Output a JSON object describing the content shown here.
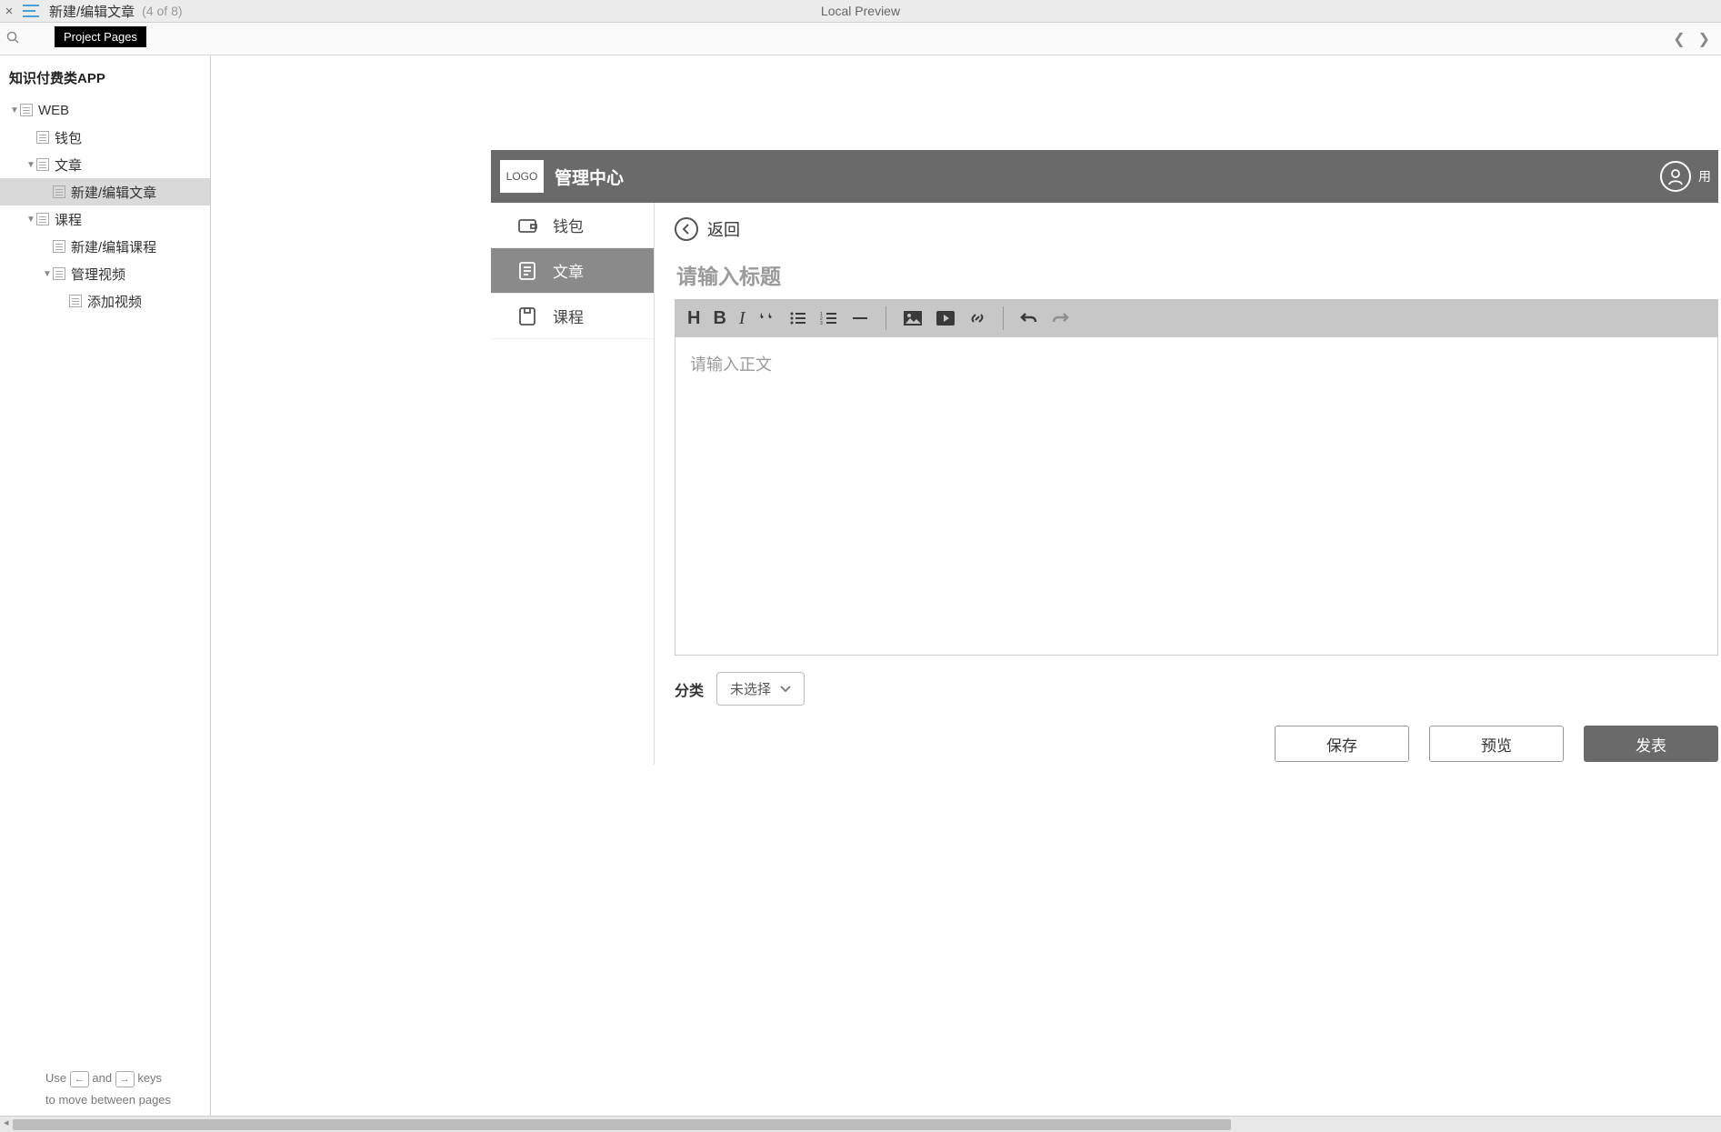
{
  "toolbar": {
    "page_title": "新建/编辑文章",
    "page_count": "(4 of 8)",
    "preview_label": "Local Preview",
    "tooltip": "Project Pages"
  },
  "project": {
    "title": "知识付费类APP"
  },
  "tree": {
    "web": "WEB",
    "wallet": "钱包",
    "article": "文章",
    "article_new": "新建/编辑文章",
    "course": "课程",
    "course_new": "新建/编辑课程",
    "video_manage": "管理视频",
    "video_add": "添加视频"
  },
  "footer": {
    "line1_pre": "Use",
    "key_left": "←",
    "line1_and": "and",
    "key_right": "→",
    "line1_post": "keys",
    "line2": "to move between pages"
  },
  "mockup": {
    "logo": "LOGO",
    "header_title": "管理中心",
    "user_partial": "用",
    "sidenav": {
      "wallet": "钱包",
      "article": "文章",
      "course": "课程"
    },
    "back": "返回",
    "title_placeholder": "请输入标题",
    "body_placeholder": "请输入正文",
    "category_label": "分类",
    "category_value": "未选择",
    "btn_save": "保存",
    "btn_preview": "预览",
    "btn_publish": "发表"
  }
}
